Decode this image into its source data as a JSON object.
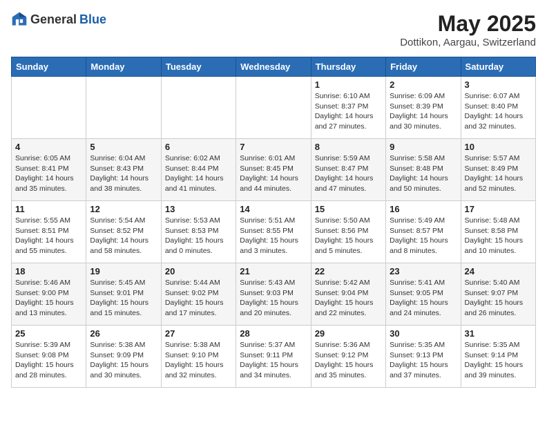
{
  "header": {
    "logo_general": "General",
    "logo_blue": "Blue",
    "title": "May 2025",
    "location": "Dottikon, Aargau, Switzerland"
  },
  "weekdays": [
    "Sunday",
    "Monday",
    "Tuesday",
    "Wednesday",
    "Thursday",
    "Friday",
    "Saturday"
  ],
  "weeks": [
    [
      {
        "day": "",
        "info": ""
      },
      {
        "day": "",
        "info": ""
      },
      {
        "day": "",
        "info": ""
      },
      {
        "day": "",
        "info": ""
      },
      {
        "day": "1",
        "info": "Sunrise: 6:10 AM\nSunset: 8:37 PM\nDaylight: 14 hours and 27 minutes."
      },
      {
        "day": "2",
        "info": "Sunrise: 6:09 AM\nSunset: 8:39 PM\nDaylight: 14 hours and 30 minutes."
      },
      {
        "day": "3",
        "info": "Sunrise: 6:07 AM\nSunset: 8:40 PM\nDaylight: 14 hours and 32 minutes."
      }
    ],
    [
      {
        "day": "4",
        "info": "Sunrise: 6:05 AM\nSunset: 8:41 PM\nDaylight: 14 hours and 35 minutes."
      },
      {
        "day": "5",
        "info": "Sunrise: 6:04 AM\nSunset: 8:43 PM\nDaylight: 14 hours and 38 minutes."
      },
      {
        "day": "6",
        "info": "Sunrise: 6:02 AM\nSunset: 8:44 PM\nDaylight: 14 hours and 41 minutes."
      },
      {
        "day": "7",
        "info": "Sunrise: 6:01 AM\nSunset: 8:45 PM\nDaylight: 14 hours and 44 minutes."
      },
      {
        "day": "8",
        "info": "Sunrise: 5:59 AM\nSunset: 8:47 PM\nDaylight: 14 hours and 47 minutes."
      },
      {
        "day": "9",
        "info": "Sunrise: 5:58 AM\nSunset: 8:48 PM\nDaylight: 14 hours and 50 minutes."
      },
      {
        "day": "10",
        "info": "Sunrise: 5:57 AM\nSunset: 8:49 PM\nDaylight: 14 hours and 52 minutes."
      }
    ],
    [
      {
        "day": "11",
        "info": "Sunrise: 5:55 AM\nSunset: 8:51 PM\nDaylight: 14 hours and 55 minutes."
      },
      {
        "day": "12",
        "info": "Sunrise: 5:54 AM\nSunset: 8:52 PM\nDaylight: 14 hours and 58 minutes."
      },
      {
        "day": "13",
        "info": "Sunrise: 5:53 AM\nSunset: 8:53 PM\nDaylight: 15 hours and 0 minutes."
      },
      {
        "day": "14",
        "info": "Sunrise: 5:51 AM\nSunset: 8:55 PM\nDaylight: 15 hours and 3 minutes."
      },
      {
        "day": "15",
        "info": "Sunrise: 5:50 AM\nSunset: 8:56 PM\nDaylight: 15 hours and 5 minutes."
      },
      {
        "day": "16",
        "info": "Sunrise: 5:49 AM\nSunset: 8:57 PM\nDaylight: 15 hours and 8 minutes."
      },
      {
        "day": "17",
        "info": "Sunrise: 5:48 AM\nSunset: 8:58 PM\nDaylight: 15 hours and 10 minutes."
      }
    ],
    [
      {
        "day": "18",
        "info": "Sunrise: 5:46 AM\nSunset: 9:00 PM\nDaylight: 15 hours and 13 minutes."
      },
      {
        "day": "19",
        "info": "Sunrise: 5:45 AM\nSunset: 9:01 PM\nDaylight: 15 hours and 15 minutes."
      },
      {
        "day": "20",
        "info": "Sunrise: 5:44 AM\nSunset: 9:02 PM\nDaylight: 15 hours and 17 minutes."
      },
      {
        "day": "21",
        "info": "Sunrise: 5:43 AM\nSunset: 9:03 PM\nDaylight: 15 hours and 20 minutes."
      },
      {
        "day": "22",
        "info": "Sunrise: 5:42 AM\nSunset: 9:04 PM\nDaylight: 15 hours and 22 minutes."
      },
      {
        "day": "23",
        "info": "Sunrise: 5:41 AM\nSunset: 9:05 PM\nDaylight: 15 hours and 24 minutes."
      },
      {
        "day": "24",
        "info": "Sunrise: 5:40 AM\nSunset: 9:07 PM\nDaylight: 15 hours and 26 minutes."
      }
    ],
    [
      {
        "day": "25",
        "info": "Sunrise: 5:39 AM\nSunset: 9:08 PM\nDaylight: 15 hours and 28 minutes."
      },
      {
        "day": "26",
        "info": "Sunrise: 5:38 AM\nSunset: 9:09 PM\nDaylight: 15 hours and 30 minutes."
      },
      {
        "day": "27",
        "info": "Sunrise: 5:38 AM\nSunset: 9:10 PM\nDaylight: 15 hours and 32 minutes."
      },
      {
        "day": "28",
        "info": "Sunrise: 5:37 AM\nSunset: 9:11 PM\nDaylight: 15 hours and 34 minutes."
      },
      {
        "day": "29",
        "info": "Sunrise: 5:36 AM\nSunset: 9:12 PM\nDaylight: 15 hours and 35 minutes."
      },
      {
        "day": "30",
        "info": "Sunrise: 5:35 AM\nSunset: 9:13 PM\nDaylight: 15 hours and 37 minutes."
      },
      {
        "day": "31",
        "info": "Sunrise: 5:35 AM\nSunset: 9:14 PM\nDaylight: 15 hours and 39 minutes."
      }
    ]
  ]
}
